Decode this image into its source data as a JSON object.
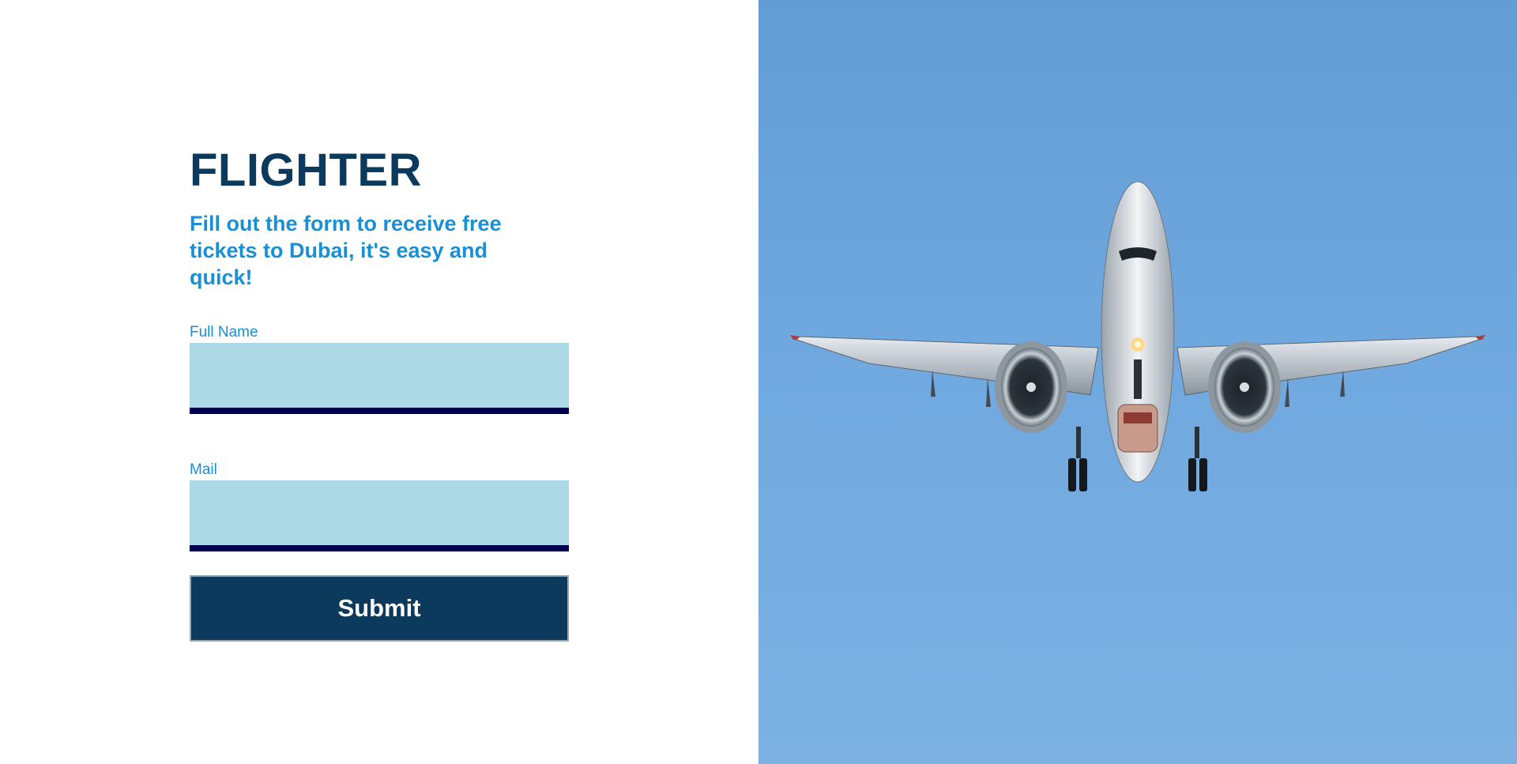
{
  "brand": "FLIGHTER",
  "tagline": "Fill out the form to receive free tickets to Dubai, it's easy and quick!",
  "form": {
    "full_name": {
      "label": "Full Name",
      "value": "",
      "placeholder": ""
    },
    "mail": {
      "label": "Mail",
      "value": "",
      "placeholder": ""
    },
    "submit_label": "Submit"
  },
  "hero": {
    "icon": "airplane-photo"
  },
  "colors": {
    "brand": "#0b3a5c",
    "accent": "#1a8fd4",
    "input_bg": "#add8e6",
    "input_border": "#000051",
    "sky": "#6fa8df"
  }
}
